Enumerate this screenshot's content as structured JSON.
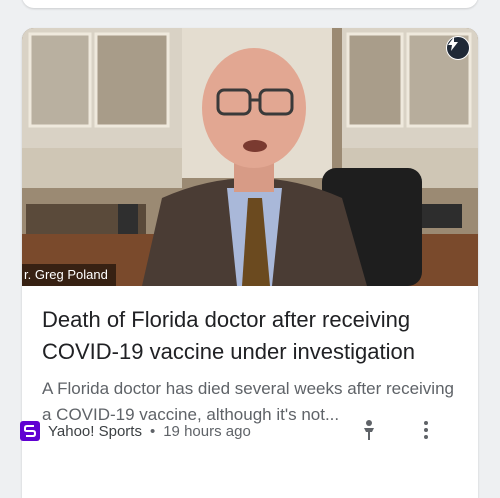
{
  "article": {
    "thumbnail_caption": "r. Greg Poland",
    "headline": "Death of Florida doctor after receiving COVID-19 vaccine under investigation",
    "snippet": "A Florida doctor has died several weeks after receiving a COVID-19 vaccine, although it's not...",
    "source": "Yahoo! Sports",
    "separator": "•",
    "time_ago": "19 hours ago",
    "icons": {
      "badge": "amp-lightning-icon",
      "source_logo": "yahoo-sports-logo-icon",
      "save": "pin-icon",
      "menu": "more-vert-icon"
    }
  },
  "colors": {
    "source_logo": "#6001d2",
    "headline": "#202124",
    "snippet": "#5f6368"
  }
}
